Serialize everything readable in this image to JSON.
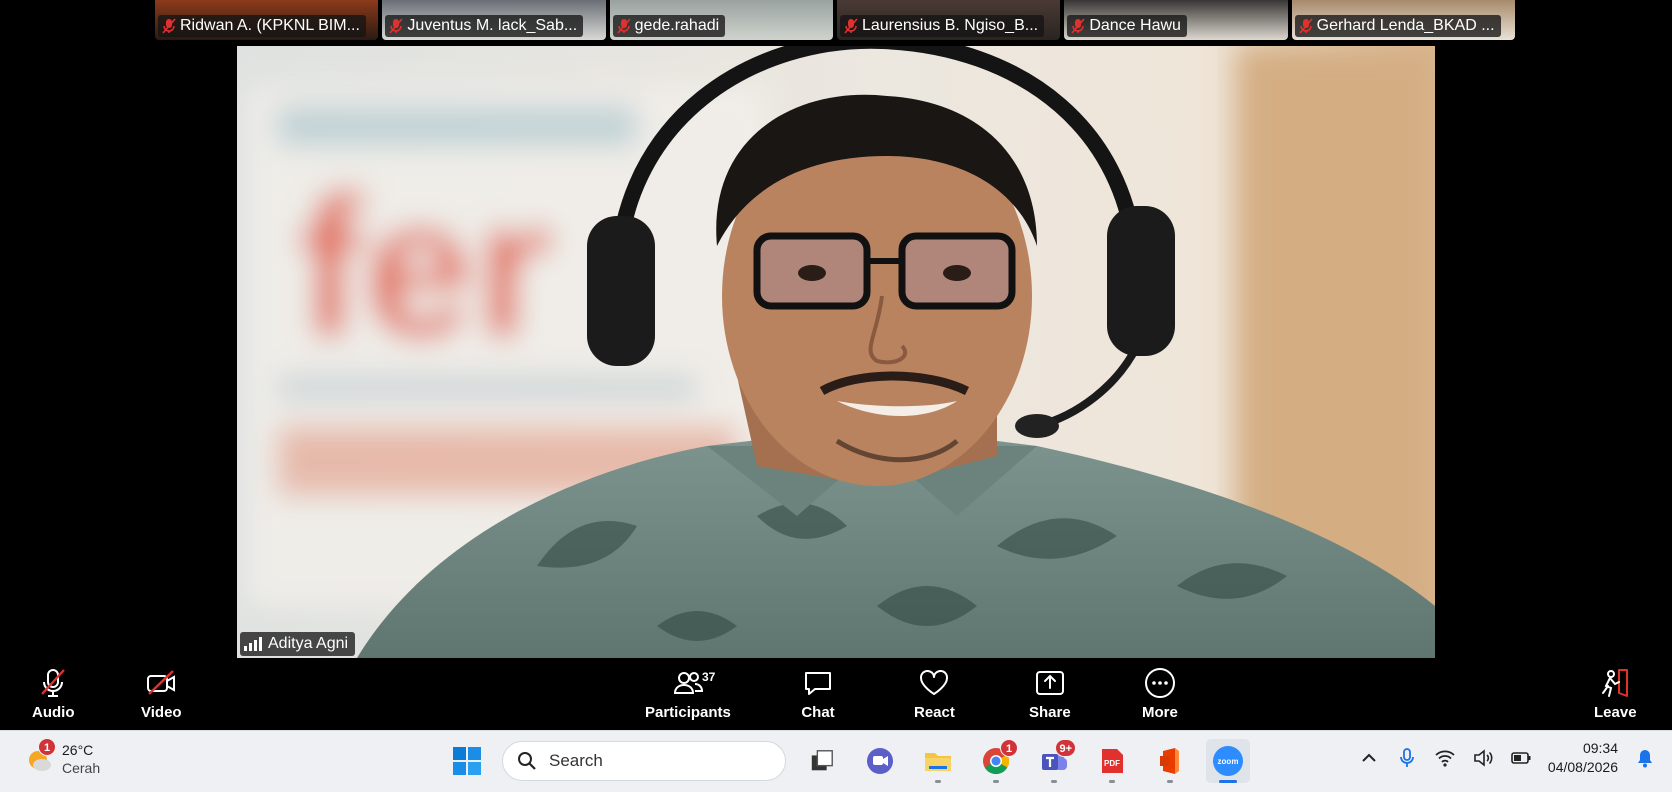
{
  "participants_strip": [
    {
      "name": "Ridwan A. (KPKNL BIM..."
    },
    {
      "name": "Juventus M. lack_Sab..."
    },
    {
      "name": "gede.rahadi"
    },
    {
      "name": "Laurensius B. Ngiso_B..."
    },
    {
      "name": "Dance Hawu"
    },
    {
      "name": "Gerhard Lenda_BKAD ..."
    }
  ],
  "speaker": {
    "name": "Aditya Agni"
  },
  "toolbar": {
    "audio_label": "Audio",
    "video_label": "Video",
    "participants_label": "Participants",
    "participants_count": "37",
    "chat_label": "Chat",
    "react_label": "React",
    "share_label": "Share",
    "more_label": "More",
    "leave_label": "Leave"
  },
  "taskbar": {
    "weather_temp": "26°C",
    "weather_desc": "Cerah",
    "weather_badge": "1",
    "search_placeholder": "Search",
    "apps": [
      {
        "icon": "task-view-icon"
      },
      {
        "icon": "chat-app-icon"
      },
      {
        "icon": "file-explorer-icon"
      },
      {
        "icon": "chrome-icon",
        "badge": "1"
      },
      {
        "icon": "teams-icon",
        "badge": "9+"
      },
      {
        "icon": "pdf-app-icon"
      },
      {
        "icon": "office-app-icon"
      },
      {
        "icon": "zoom-app-icon",
        "label": "zoom"
      }
    ],
    "time": "09:34",
    "date": "04/08/2026"
  },
  "colors": {
    "accent": "#1a73e8",
    "danger": "#e0312f",
    "toolbar_bg": "#000000",
    "taskbar_bg": "#eef0f4"
  }
}
